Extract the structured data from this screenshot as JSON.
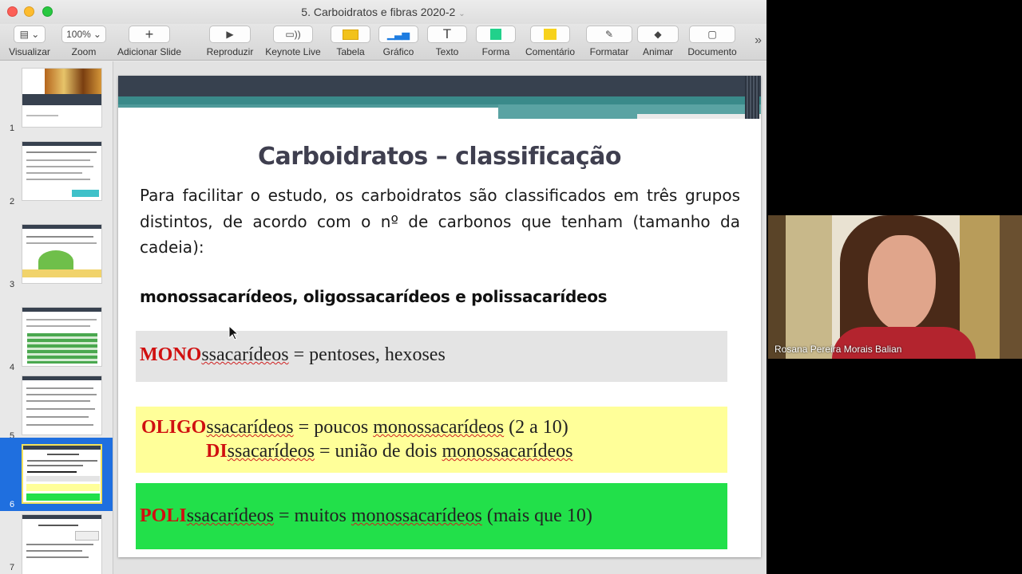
{
  "window": {
    "title": "5. Carboidratos e fibras 2020-2"
  },
  "toolbar": {
    "view_label": "Visualizar",
    "zoom_value": "100%",
    "zoom_label": "Zoom",
    "add_slide_label": "Adicionar Slide",
    "play_label": "Reproduzir",
    "keynote_live_label": "Keynote Live",
    "table_label": "Tabela",
    "chart_label": "Gráfico",
    "text_label": "Texto",
    "shape_label": "Forma",
    "comment_label": "Comentário",
    "format_label": "Formatar",
    "animate_label": "Animar",
    "document_label": "Documento",
    "more_glyph": "»"
  },
  "sidebar": {
    "slides": [
      {
        "number": "1"
      },
      {
        "number": "2"
      },
      {
        "number": "3"
      },
      {
        "number": "4"
      },
      {
        "number": "5"
      },
      {
        "number": "6",
        "selected": true
      },
      {
        "number": "7"
      }
    ]
  },
  "slide": {
    "title": "Carboidratos – classificação",
    "intro": "Para facilitar o estudo, os carboidratos são classificados em três grupos distintos, de acordo com o nº de carbonos que tenham (tamanho da cadeia):",
    "groups": "monossacarídeos, oligossacarídeos e polissacarídeos",
    "mono": {
      "prefix": "MONO",
      "rest": "ssacarídeos",
      "eq": " = pentoses, hexoses"
    },
    "oligo": {
      "prefix": "OLIGO",
      "rest": "ssacarídeos",
      "eq1": " = poucos ",
      "word": "monossacarídeos",
      "eq2": " (2 a 10)"
    },
    "di": {
      "prefix": "DI",
      "rest": "ssacarídeos",
      "eq1": " = união de dois ",
      "word": "monossacarídeos"
    },
    "poli": {
      "prefix": "POLI",
      "rest": "ssacarídeos",
      "eq1": " = muitos ",
      "word": "monossacarídeos",
      "eq2": " (mais que 10)"
    }
  },
  "webcam": {
    "participant_name": "Rosana Pereira Morais Balian"
  },
  "colors": {
    "selection": "#1f6fdf",
    "mono_box": "#e4e4e4",
    "oligo_box": "#ffff99",
    "poli_box": "#22e04a",
    "prefix_red": "#d01010"
  }
}
